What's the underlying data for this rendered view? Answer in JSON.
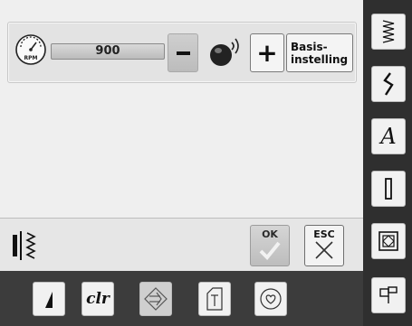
{
  "speed_panel": {
    "speed_value": "900",
    "rpm_label": "RPM",
    "basis_label_line1": "Basis-",
    "basis_label_line2": "instelling"
  },
  "status_row": {
    "ok_label": "OK",
    "esc_label": "ESC"
  },
  "right_toolbar": {
    "items": [
      {
        "name": "zigzag-stitch-icon"
      },
      {
        "name": "lightning-stitch-icon"
      },
      {
        "name": "alphabet-icon",
        "label": "A"
      },
      {
        "name": "buttonhole-icon"
      },
      {
        "name": "quilt-icon"
      },
      {
        "name": "presser-foot-icon"
      }
    ],
    "alphabet_label": "A"
  },
  "bottom_toolbar": {
    "items": [
      {
        "name": "needle-position-icon"
      },
      {
        "name": "clear-button",
        "label": "clr"
      },
      {
        "name": "navigation-icon",
        "active": true
      },
      {
        "name": "tack-icon"
      },
      {
        "name": "favorite-icon"
      }
    ],
    "clr_label": "clr"
  },
  "colors": {
    "screen_bg": "#efefef",
    "sidebar_bg": "#2f2f2f",
    "button_bg": "#f1f1f1",
    "ok_check_gray": "#bdbdbd"
  }
}
